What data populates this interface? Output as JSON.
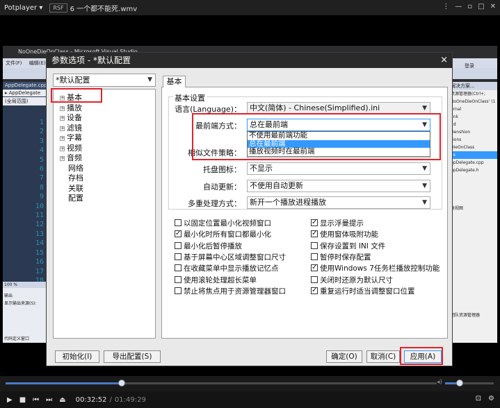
{
  "player": {
    "logo": "Potplayer ▾",
    "tag": "RSF",
    "file": "6 一个都不能死.wmv",
    "time_current": "00:32:52",
    "time_total": "01:49:29",
    "seek_fraction": 0.27,
    "volume_fraction": 0.3
  },
  "vs": {
    "title": "NoOneDieOnClass - Microsoft Visual Studio",
    "menu": [
      "文件(F)",
      "编辑(E)"
    ],
    "user": "登录",
    "left_tab": "AppDelegate.cpp",
    "left_sub": "▸ AppDelegate",
    "left_scope": "(全局范围)",
    "line_numbers": [
      "1",
      "2",
      "3",
      "4",
      "5",
      "6",
      "7",
      "8",
      "9",
      "10",
      "11",
      "12",
      "13",
      "14",
      "15",
      "16",
      "17",
      "18"
    ],
    "zoom": "100 %",
    "output_label": "输出",
    "output_src": "显示输出来源(S):",
    "bottom_status": "代码定义窗口",
    "right_header": "解决方案...",
    "right_search": "资源管理器(Ctrl+;",
    "right_items": [
      "NoOneDieOnClass' (1",
      "ernal",
      "ank",
      "2d",
      "Denshion",
      "sions",
      "DieOnClass",
      "es",
      "ppDelegate.cpp",
      "ppDelegate.h",
      "",
      "",
      "",
      "",
      "类视图",
      "",
      "",
      "",
      "",
      "",
      "",
      "",
      "",
      "",
      "",
      "",
      "",
      "",
      "团队资源管理器"
    ]
  },
  "dialog": {
    "title": "参数选项 - *默认配置",
    "close": "×",
    "profile": "*默认配置",
    "tree": [
      {
        "label": "基本",
        "expand": "+"
      },
      {
        "label": "播放",
        "expand": "+"
      },
      {
        "label": "设备",
        "expand": "+"
      },
      {
        "label": "滤镜",
        "expand": "+"
      },
      {
        "label": "字幕",
        "expand": "+"
      },
      {
        "label": "视频",
        "expand": "+"
      },
      {
        "label": "音频",
        "expand": "+"
      },
      {
        "label": "网络",
        "expand": ""
      },
      {
        "label": "存档",
        "expand": ""
      },
      {
        "label": "关联",
        "expand": ""
      },
      {
        "label": "配置",
        "expand": ""
      }
    ],
    "tab": "基本",
    "section": "基本设置",
    "language_label": "语言(Language)：",
    "language_value": "中文(简体) - Chinese(Simplified).ini",
    "ontop_label": "最前端方式：",
    "ontop_value": "总在最前端",
    "ontop_options": [
      "不使用最前端功能",
      "总在最前端",
      "播放视频时在最前端"
    ],
    "similar_label": "相似文件策略：",
    "tray_label": "托盘图标：",
    "tray_value": "不显示",
    "update_label": "自动更新：",
    "update_value": "不使用自动更新",
    "multi_label": "多重处理方式：",
    "multi_value": "新开一个播放进程播放",
    "checks_left": [
      {
        "label": "以固定位置最小化视频窗口",
        "checked": false
      },
      {
        "label": "最小化时所有窗口都最小化",
        "checked": true
      },
      {
        "label": "最小化后暂停播放",
        "checked": false
      },
      {
        "label": "基于屏幕中心区域调整窗口尺寸",
        "checked": false
      },
      {
        "label": "在收藏菜单中显示播放记忆点",
        "checked": false
      },
      {
        "label": "使用滚轮处理超长菜单",
        "checked": false
      },
      {
        "label": "禁止将焦点用于资源管理器窗口",
        "checked": false
      }
    ],
    "checks_right": [
      {
        "label": "显示浮曼提示",
        "checked": true
      },
      {
        "label": "使用窗体吸附功能",
        "checked": true
      },
      {
        "label": "保存设置到 INI 文件",
        "checked": false
      },
      {
        "label": "暂停时保存配置",
        "checked": false
      },
      {
        "label": "使用Windows 7任务栏播放控制功能",
        "checked": true
      },
      {
        "label": "关闭时还原为默认尺寸",
        "checked": false
      },
      {
        "label": "重复运行时适当调整窗口位置",
        "checked": true
      }
    ],
    "btn_init": "初始化(I)",
    "btn_export": "导出配置(S)",
    "btn_ok": "确定(O)",
    "btn_cancel": "取消(C)",
    "btn_apply": "应用(A)"
  }
}
